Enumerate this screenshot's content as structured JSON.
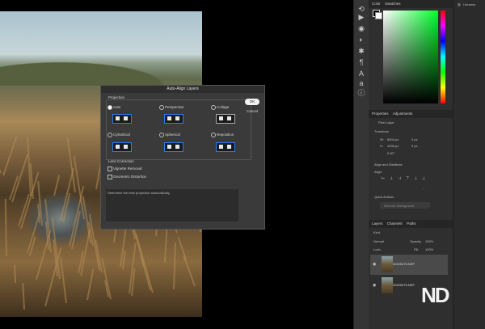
{
  "panels": {
    "color_tab": "Color",
    "swatches_tab": "Swatches",
    "libraries_tab": "Libraries",
    "properties_tab": "Properties",
    "adjustments_tab": "Adjustments",
    "pixel_layer": "Pixel Layer",
    "transform_header": "Transform",
    "w_label": "W:",
    "w_value": "6504 px",
    "h_label": "H:",
    "h_value": "4336 px",
    "x_value": "0 px",
    "y_value": "0 px",
    "angle_value": "0.00°",
    "align_header": "Align and Distribute",
    "align_label": "Align:",
    "more_dots": "...",
    "quick_actions_header": "Quick Actions",
    "remove_background": "Remove Background",
    "layers_tab": "Layers",
    "channels_tab": "Channels",
    "paths_tab": "Paths",
    "kind_label": "Kind",
    "blend_mode": "Normal",
    "opacity_label": "Opacity:",
    "opacity_value": "100%",
    "lock_label": "Lock:",
    "fill_label": "Fill:",
    "fill_value": "100%",
    "layers": [
      {
        "name": "20220076.NEF"
      },
      {
        "name": "20220076.NEF"
      }
    ]
  },
  "dialog": {
    "title": "Auto-Align Layers",
    "projection_label": "Projection",
    "options": [
      {
        "label": "Auto",
        "selected": true
      },
      {
        "label": "Perspective",
        "selected": false
      },
      {
        "label": "Collage",
        "selected": false
      },
      {
        "label": "Cylindrical",
        "selected": false
      },
      {
        "label": "Spherical",
        "selected": false
      },
      {
        "label": "Reposition",
        "selected": false
      }
    ],
    "ok_label": "OK",
    "cancel_label": "Cancel",
    "lens_correction_label": "Lens Correction",
    "vignette_label": "Vignette Removal",
    "distortion_label": "Geometric Distortion",
    "description": "Determine the best projection automatically."
  },
  "watermark": "ND",
  "colors": {
    "accent_blue": "#2b7de9",
    "panel_bg": "#2f2f2f",
    "dialog_bg": "#3a3a3a"
  }
}
